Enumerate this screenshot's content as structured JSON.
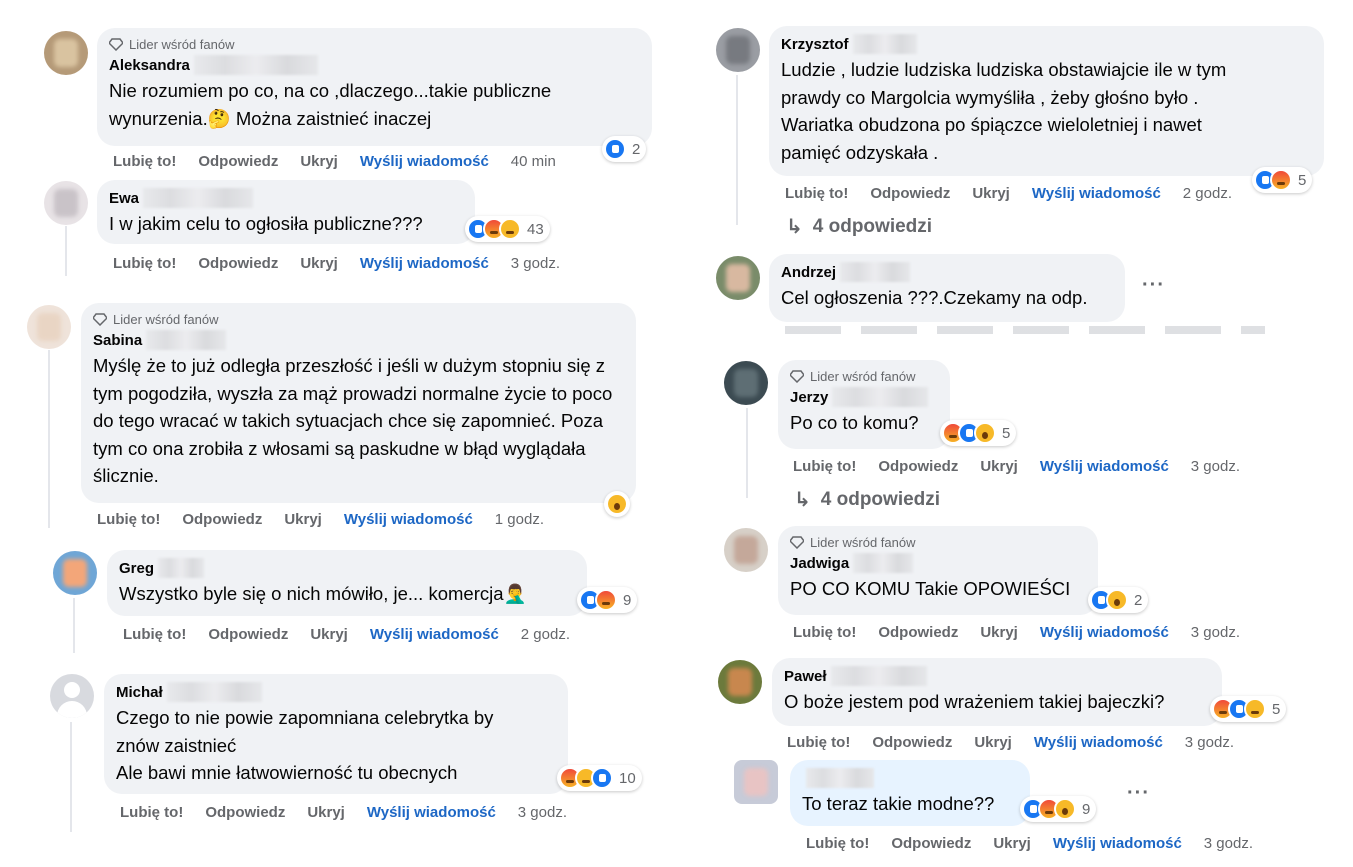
{
  "actions": {
    "like": "Lubię to!",
    "reply": "Odpowiedz",
    "hide": "Ukryj",
    "message": "Wyślij wiadomość"
  },
  "badge_label": "Lider wśród fanów",
  "comments_left": [
    {
      "author": "Aleksandra",
      "text": "Nie rozumiem po co, na co ,dlaczego...takie publiczne wynurzenia.🤔 Można zaistnieć inaczej",
      "time": "40 min",
      "reactions": [
        "like"
      ],
      "count": "2"
    },
    {
      "author": "Ewa",
      "text": "I w jakim celu to ogłosiła publiczne???",
      "time": "3 godz.",
      "reactions": [
        "like",
        "angry",
        "haha"
      ],
      "count": "43"
    },
    {
      "author": "Sabina",
      "text": "Myślę że to już odległa przeszłość i jeśli w dużym stopniu się z tym pogodziła, wyszła za mąż prowadzi normalne życie to poco do tego wracać w takich sytuacjach chce się zapomnieć. Poza tym co ona zrobiła z włosami są paskudne w błąd wyglądała ślicznie.",
      "time": "1 godz.",
      "reactions": [
        "wow"
      ],
      "count": ""
    },
    {
      "author": "Greg",
      "text": "Wszystko byle się o nich mówiło, je... komercja🤦‍♂️",
      "time": "2 godz.",
      "reactions": [
        "like",
        "angry"
      ],
      "count": "9"
    },
    {
      "author": "Michał",
      "text_lines": [
        "Czego to nie powie zapomniana celebrytka by",
        "znów zaistnieć",
        "Ale bawi mnie łatwowierność tu obecnych"
      ],
      "time": "3 godz.",
      "reactions": [
        "angry",
        "haha",
        "like"
      ],
      "count": "10"
    }
  ],
  "comments_right": [
    {
      "author": "Krzysztof",
      "text_lines": [
        "Ludzie , ludzie ludziska ludziska obstawiajcie ile w tym",
        "prawdy co Margolcia wymyśliła , żeby głośno było .",
        "Wariatka obudzona po śpiączce wieloletniej i nawet",
        "pamięć odzyskała ."
      ],
      "time": "2 godz.",
      "reactions": [
        "like",
        "angry"
      ],
      "count": "5",
      "replies": "4 odpowiedzi"
    },
    {
      "author": "Andrzej",
      "text": "Cel ogłoszenia ???.Czekamy na odp."
    },
    {
      "author": "Jerzy",
      "text": "Po co to komu?",
      "time": "3 godz.",
      "reactions": [
        "angry",
        "like",
        "wow"
      ],
      "count": "5",
      "replies": "4 odpowiedzi"
    },
    {
      "author": "Jadwiga",
      "text": "PO CO KOMU Takie OPOWIEŚCI",
      "time": "3 godz.",
      "reactions": [
        "like",
        "wow"
      ],
      "count": "2"
    },
    {
      "author": "Paweł",
      "text": "O boże jestem pod wrażeniem takiej bajeczki?",
      "time": "3 godz.",
      "reactions": [
        "angry",
        "like",
        "haha"
      ],
      "count": "5"
    },
    {
      "author": "",
      "text": "To teraz takie modne??",
      "time": "3 godz.",
      "reactions": [
        "like",
        "angry",
        "wow"
      ],
      "count": "9"
    }
  ],
  "colors": {
    "bubble": "#f0f2f5",
    "bubble_highlight": "#e7f3ff",
    "link": "#1d67c5",
    "meta": "#65676b"
  }
}
